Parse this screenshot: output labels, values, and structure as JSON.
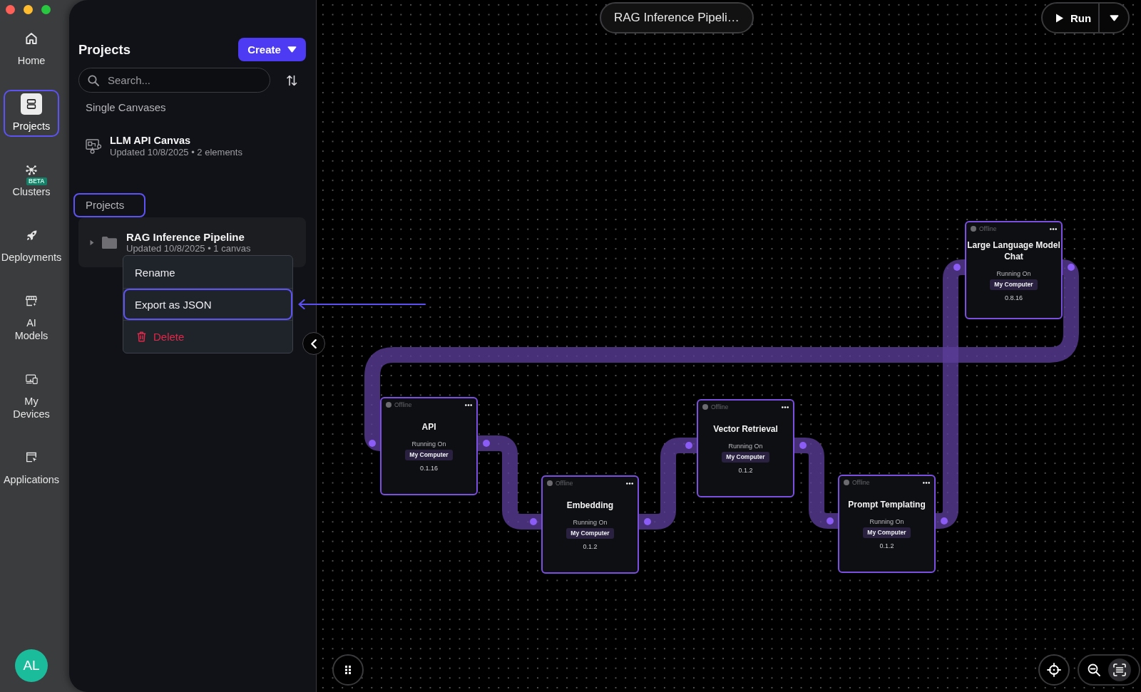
{
  "sidebar": {
    "items": [
      {
        "label": "Home",
        "selected": false,
        "highlighted": false
      },
      {
        "label": "Projects",
        "selected": true,
        "highlighted": true
      },
      {
        "label": "Clusters",
        "selected": false,
        "highlighted": false,
        "badge": "BETA"
      },
      {
        "label": "Deployments",
        "selected": false,
        "highlighted": false
      },
      {
        "label": "AI Models",
        "selected": false,
        "highlighted": false
      },
      {
        "label": "My Devices",
        "selected": false,
        "highlighted": false
      },
      {
        "label": "Applications",
        "selected": false,
        "highlighted": false
      }
    ],
    "avatar": "AL"
  },
  "projects_panel": {
    "title": "Projects",
    "create_button": "Create",
    "search": {
      "placeholder": "Search..."
    },
    "sections": [
      {
        "label": "Single Canvases",
        "highlighted": false,
        "items": [
          {
            "kind": "canvas",
            "title": "LLM API Canvas",
            "subtitle": "Updated 10/8/2025 • 2 elements"
          }
        ]
      },
      {
        "label": "Projects",
        "highlighted": true,
        "items": [
          {
            "kind": "project",
            "title": "RAG Inference Pipeline",
            "subtitle": "Updated 10/8/2025 • 1 canvas",
            "expanded": false
          }
        ]
      }
    ],
    "context_menu": {
      "items": [
        {
          "label": "Rename",
          "kind": "plain",
          "highlighted": false,
          "pointer": false
        },
        {
          "label": "Export as JSON",
          "kind": "plain",
          "highlighted": true,
          "pointer": true
        },
        {
          "label": "Delete",
          "kind": "danger",
          "highlighted": false,
          "pointer": false
        }
      ]
    }
  },
  "canvas": {
    "title": "RAG Inference Pipeli…",
    "run_button": "Run",
    "nodes": [
      {
        "title": "API",
        "status": "Offline",
        "host_label": "Running On",
        "host": "My Computer",
        "version": "0.1.16",
        "linked_to_next": true
      },
      {
        "title": "Embedding",
        "status": "Offline",
        "host_label": "Running On",
        "host": "My Computer",
        "version": "0.1.2",
        "linked_to_next": true
      },
      {
        "title": "Vector Retrieval",
        "status": "Offline",
        "host_label": "Running On",
        "host": "My Computer",
        "version": "0.1.2",
        "linked_to_next": true
      },
      {
        "title": "Prompt Templating",
        "status": "Offline",
        "host_label": "Running On",
        "host": "My Computer",
        "version": "0.1.2",
        "linked_to_next": true
      },
      {
        "title": "Large Language Model Chat",
        "status": "Offline",
        "host_label": "Running On",
        "host": "My Computer",
        "version": "0.8.16",
        "linked_to_next": true
      }
    ]
  }
}
